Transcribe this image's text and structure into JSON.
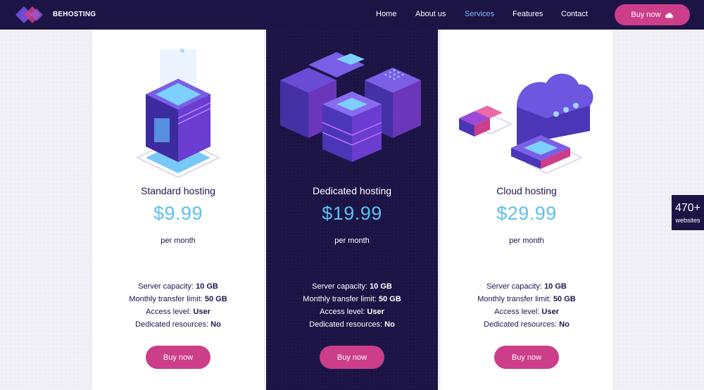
{
  "header": {
    "brand": "BEHOSTING",
    "nav": [
      "Home",
      "About us",
      "Services",
      "Features",
      "Contact"
    ],
    "active_nav": "Services",
    "buy_label": "Buy now",
    "buy_icon": "cloud-icon"
  },
  "plans": [
    {
      "title": "Standard hosting",
      "price": "$9.99",
      "period": "per month",
      "features": [
        {
          "label": "Server capacity:",
          "value": "10 GB"
        },
        {
          "label": "Monthly transfer limit:",
          "value": "50 GB"
        },
        {
          "label": "Access level:",
          "value": "User"
        },
        {
          "label": "Dedicated resources:",
          "value": "No"
        }
      ],
      "button": "Buy now"
    },
    {
      "title": "Dedicated hosting",
      "price": "$19.99",
      "period": "per month",
      "features": [
        {
          "label": "Server capacity:",
          "value": "10 GB"
        },
        {
          "label": "Monthly transfer limit:",
          "value": "50 GB"
        },
        {
          "label": "Access level:",
          "value": "User"
        },
        {
          "label": "Dedicated resources:",
          "value": "No"
        }
      ],
      "button": "Buy now"
    },
    {
      "title": "Cloud hosting",
      "price": "$29.99",
      "period": "per month",
      "features": [
        {
          "label": "Server capacity:",
          "value": "10 GB"
        },
        {
          "label": "Monthly transfer limit:",
          "value": "50 GB"
        },
        {
          "label": "Access level:",
          "value": "User"
        },
        {
          "label": "Dedicated resources:",
          "value": "No"
        }
      ],
      "button": "Buy now"
    }
  ],
  "badge": {
    "count": "470+",
    "label": "websites"
  },
  "colors": {
    "navy": "#1c1444",
    "accent": "#cc3d8a",
    "price": "#5cc1ec",
    "active_nav": "#7fb6ff"
  }
}
